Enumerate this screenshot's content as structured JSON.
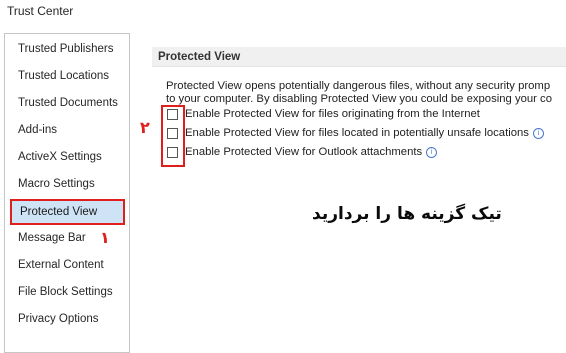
{
  "window": {
    "title": "Trust Center"
  },
  "sidebar": {
    "items": [
      {
        "label": "Trusted Publishers"
      },
      {
        "label": "Trusted Locations"
      },
      {
        "label": "Trusted Documents"
      },
      {
        "label": "Add-ins"
      },
      {
        "label": "ActiveX Settings"
      },
      {
        "label": "Macro Settings"
      },
      {
        "label": "Protected View",
        "selected": true
      },
      {
        "label": "Message Bar"
      },
      {
        "label": "External Content"
      },
      {
        "label": "File Block Settings"
      },
      {
        "label": "Privacy Options"
      }
    ]
  },
  "main": {
    "section_title": "Protected View",
    "description_line1": "Protected View opens potentially dangerous files, without any security promp",
    "description_line2": "to your computer. By disabling Protected View you could be exposing your co",
    "options": [
      {
        "label": "Enable Protected View for files originating from the Internet",
        "checked": false,
        "info_icon": false
      },
      {
        "label": "Enable Protected View for files located in potentially unsafe locations",
        "checked": false,
        "info_icon": true
      },
      {
        "label": "Enable Protected View for Outlook attachments",
        "checked": false,
        "info_icon": true
      }
    ]
  },
  "annotations": {
    "step1": "۱",
    "step2": "۲",
    "instruction": "تیک گزینه ها را بردارید",
    "highlight_color": "#e01e1e"
  },
  "icons": {
    "info": "info-icon"
  }
}
